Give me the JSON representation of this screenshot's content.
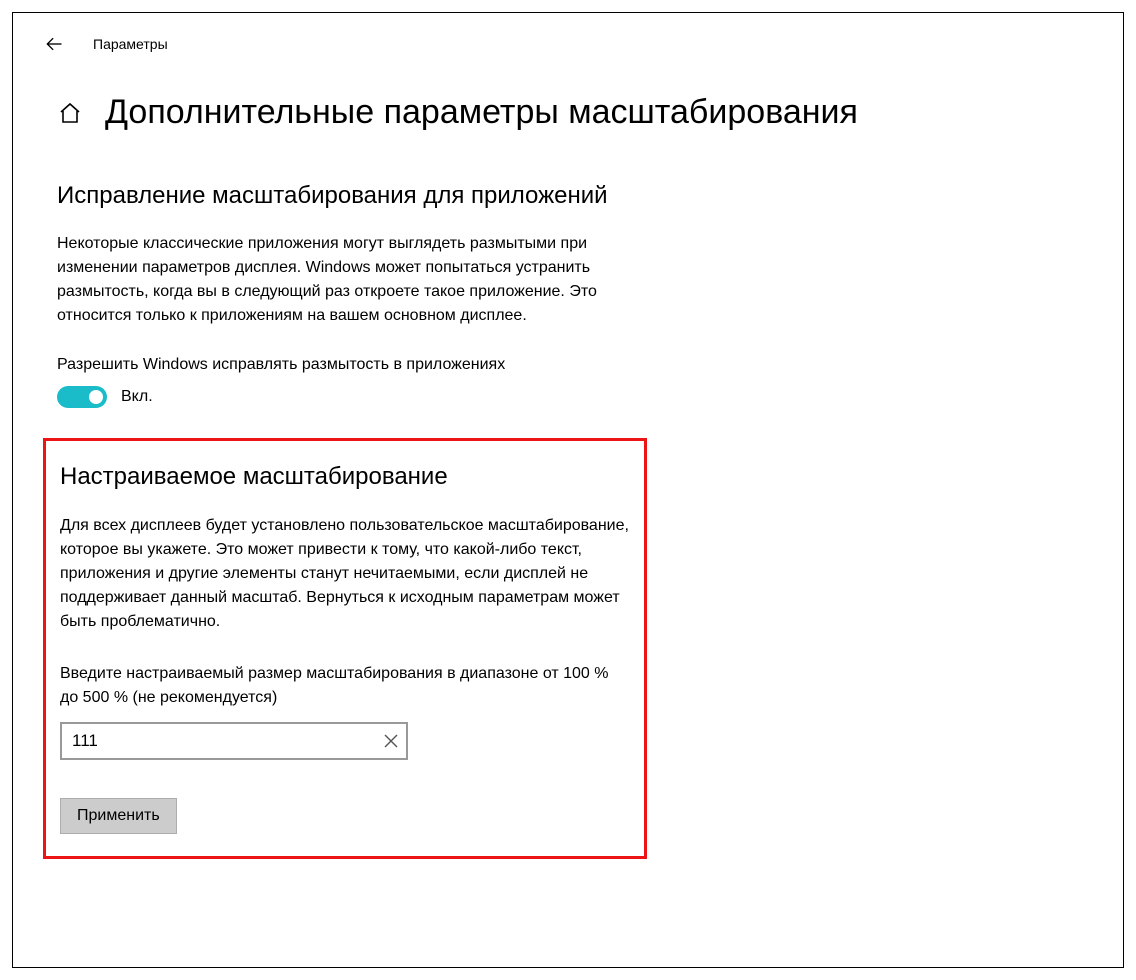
{
  "app": {
    "title": "Параметры"
  },
  "header": {
    "page_title": "Дополнительные параметры масштабирования"
  },
  "section_fix": {
    "heading": "Исправление масштабирования для приложений",
    "description": "Некоторые классические приложения могут выглядеть размытыми при изменении параметров дисплея. Windows может попытаться устранить размытость, когда вы в следующий раз откроете такое приложение. Это относится только к приложениям на вашем основном дисплее.",
    "toggle_caption": "Разрешить Windows исправлять размытость в приложениях",
    "toggle_state": "Вкл."
  },
  "section_custom": {
    "heading": "Настраиваемое масштабирование",
    "description": "Для всех дисплеев будет установлено пользовательское масштабирование, которое вы укажете. Это может привести к тому, что какой-либо текст, приложения и другие элементы станут нечитаемыми, если дисплей не поддерживает данный масштаб. Вернуться к исходным параметрам может быть проблематично.",
    "input_label": "Введите настраиваемый размер масштабирования в диапазоне от 100 % до 500 % (не рекомендуется)",
    "input_value": "111",
    "apply_label": "Применить"
  }
}
